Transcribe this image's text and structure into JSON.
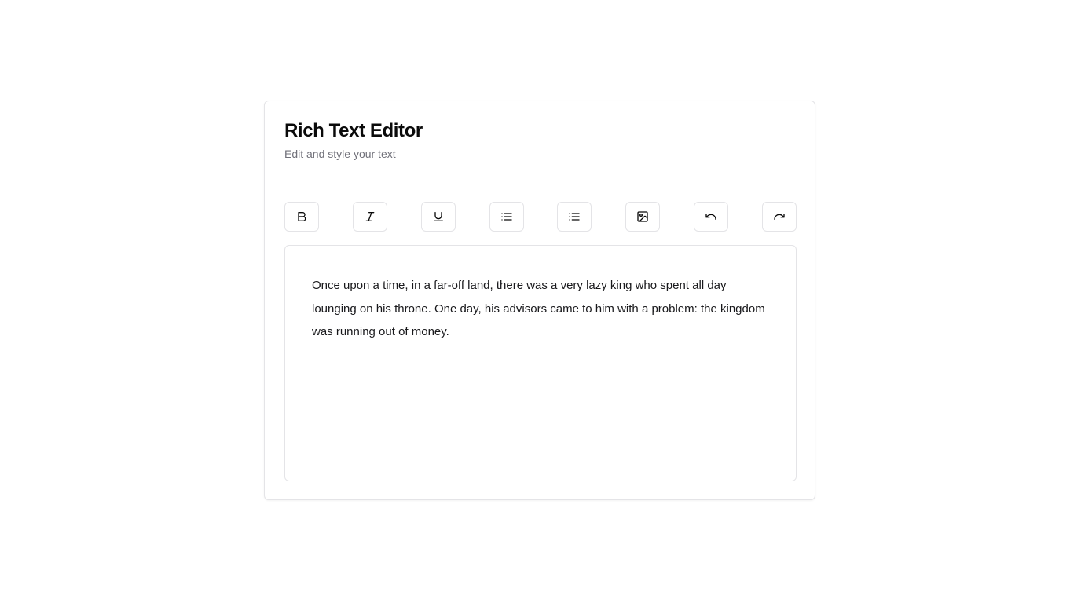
{
  "header": {
    "title": "Rich Text Editor",
    "subtitle": "Edit and style your text"
  },
  "toolbar": {
    "buttons": [
      {
        "name": "bold",
        "icon": "bold-icon"
      },
      {
        "name": "italic",
        "icon": "italic-icon"
      },
      {
        "name": "underline",
        "icon": "underline-icon"
      },
      {
        "name": "bullet-list",
        "icon": "list-icon"
      },
      {
        "name": "numbered-list",
        "icon": "list-icon"
      },
      {
        "name": "insert-image",
        "icon": "image-icon"
      },
      {
        "name": "undo",
        "icon": "undo-icon"
      },
      {
        "name": "redo",
        "icon": "redo-icon"
      }
    ]
  },
  "editor": {
    "content": "Once upon a time, in a far-off land, there was a very lazy king who spent all day lounging on his throne. One day, his advisors came to him with a problem: the kingdom was running out of money."
  },
  "colors": {
    "border": "#e4e4e7",
    "title": "#0a0a0a",
    "subtitle": "#71717a",
    "text": "#18181b"
  }
}
